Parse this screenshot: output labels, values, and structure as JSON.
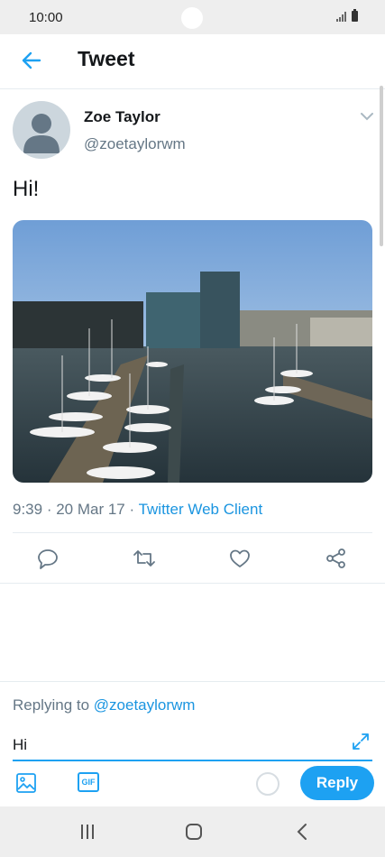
{
  "status_bar": {
    "time": "10:00"
  },
  "header": {
    "title": "Tweet"
  },
  "tweet": {
    "author_name": "Zoe Taylor",
    "author_handle": "@zoetaylorwm",
    "text": "Hi!",
    "time": "9:39",
    "date": "20 Mar 17",
    "separator": " · ",
    "client": "Twitter Web Client"
  },
  "actions": [
    "reply-icon",
    "retweet-icon",
    "like-icon",
    "share-icon"
  ],
  "reply": {
    "prefix": "Replying to ",
    "to": "@zoetaylorwm",
    "value": "Hi",
    "button_label": "Reply",
    "gif_label": "GIF"
  },
  "colors": {
    "accent": "#1da1f2",
    "link": "#1b95e0",
    "muted": "#657786"
  }
}
